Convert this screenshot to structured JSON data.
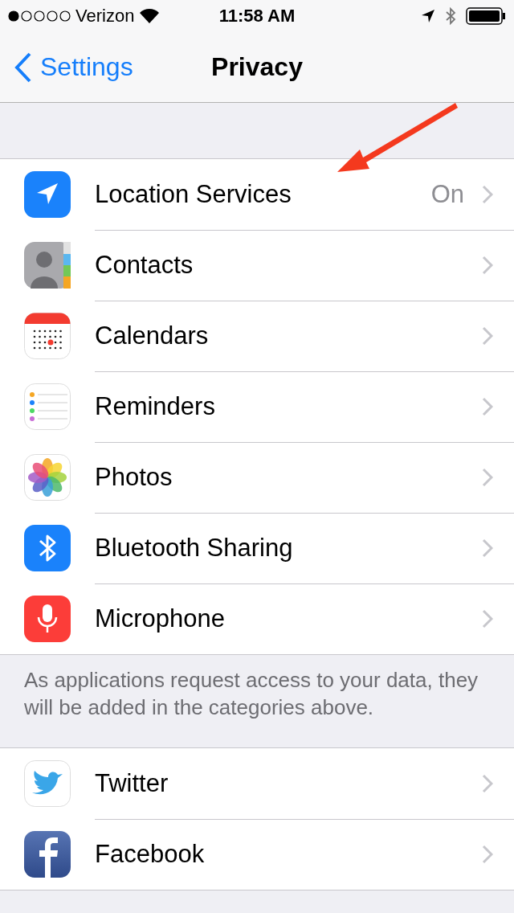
{
  "status_bar": {
    "carrier": "Verizon",
    "time": "11:58 AM"
  },
  "nav": {
    "back_label": "Settings",
    "title": "Privacy"
  },
  "sections": [
    {
      "rows": [
        {
          "label": "Location Services",
          "kind": "location",
          "value": "On"
        },
        {
          "label": "Contacts",
          "kind": "contacts"
        },
        {
          "label": "Calendars",
          "kind": "calendar"
        },
        {
          "label": "Reminders",
          "kind": "reminders"
        },
        {
          "label": "Photos",
          "kind": "photos"
        },
        {
          "label": "Bluetooth Sharing",
          "kind": "bluetooth"
        },
        {
          "label": "Microphone",
          "kind": "microphone"
        }
      ],
      "footer": "As applications request access to your data, they will be added in the categories above."
    },
    {
      "rows": [
        {
          "label": "Twitter",
          "kind": "twitter"
        },
        {
          "label": "Facebook",
          "kind": "facebook"
        }
      ]
    }
  ]
}
